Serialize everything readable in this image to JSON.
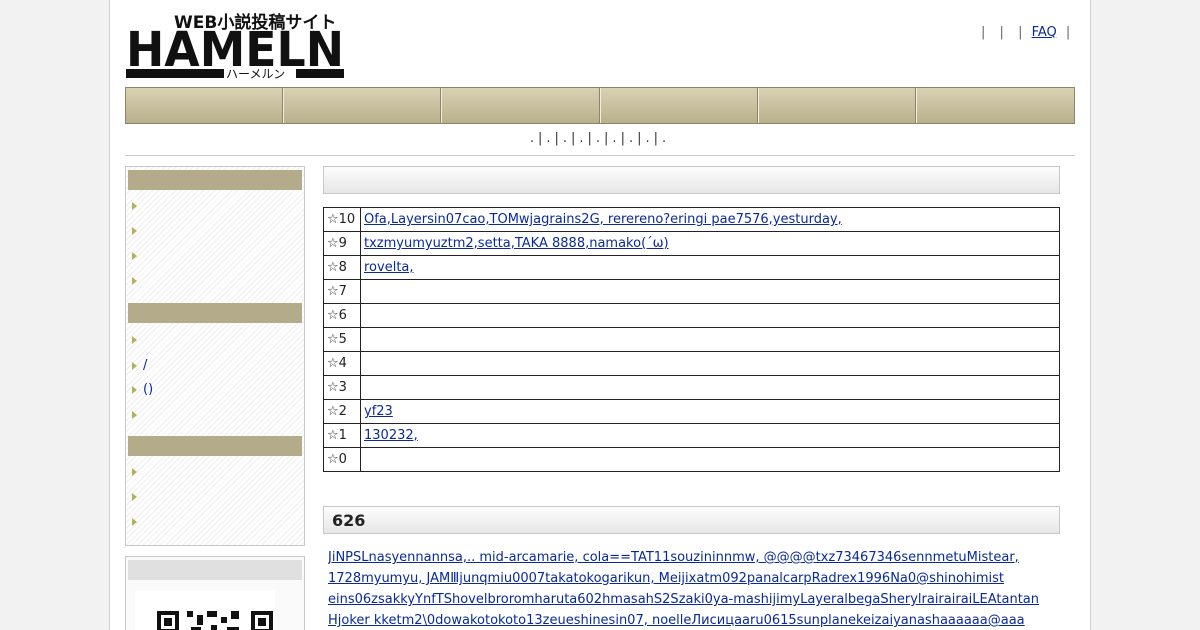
{
  "header": {
    "logo": {
      "tagline": "WEB小説投稿サイト",
      "wordmark": "HAMELN",
      "kana": "ハーメルン"
    },
    "top_links": {
      "separators": "|",
      "faq": "FAQ"
    }
  },
  "nav": {
    "tab_count": 6
  },
  "subnav": {
    "text": ".|.|.|.|.|.|.|.|."
  },
  "sidebar": {
    "sections": [
      {
        "items": [
          "",
          "",
          "",
          ""
        ]
      },
      {
        "items": [
          "",
          "/",
          "()",
          ""
        ]
      },
      {
        "items": [
          "",
          "",
          ""
        ]
      }
    ]
  },
  "rating": {
    "rows": [
      {
        "star": "☆10",
        "names": "Ofa,Layersin07cao,TOMwjagrains2G,         rerereno?eringi    pae7576,yesturday,"
      },
      {
        "star": "☆9",
        "names": "txzmyumyuztm2,setta,TAKA 8888,namako(´ω)     "
      },
      {
        "star": "☆8",
        "names": "rovelta,"
      },
      {
        "star": "☆7",
        "names": ""
      },
      {
        "star": "☆6",
        "names": ""
      },
      {
        "star": "☆5",
        "names": ""
      },
      {
        "star": "☆4",
        "names": ""
      },
      {
        "star": "☆3",
        "names": ""
      },
      {
        "star": "☆2",
        "names": "yf23"
      },
      {
        "star": "☆1",
        "names": "130232,"
      },
      {
        "star": "☆0",
        "names": ""
      }
    ]
  },
  "voters": {
    "count": "626",
    "lines": [
      "JiNPSLnasyennannsa,..   mid-arcamarie,      cola==TAT11souzininnmw,  @@@@txz73467346sennmetuMistear,      ",
      "1728myumyu,    JAMⅢjunqmiu0007takatokogarikun,   Meijixatm092panalcarpRadrex1996Na0@shinohimist",
      "eins06zsakkyYnfTShovelbroromharuta602hmasahS2Szaki0ya-mashijimyLayeralbegaSherylrairairaiLEAtantan",
      "Hjoker      kketm2\\0dowakotokoto13zeueshinesin07,   noelleЛисицaaru0615sunplanekeizaiyanashaaaaaa@aaa"
    ]
  },
  "colors": {
    "nav_bg": "#c7bf9c",
    "sidebar_head": "#b4ab8b",
    "link": "#0a2a9a"
  }
}
